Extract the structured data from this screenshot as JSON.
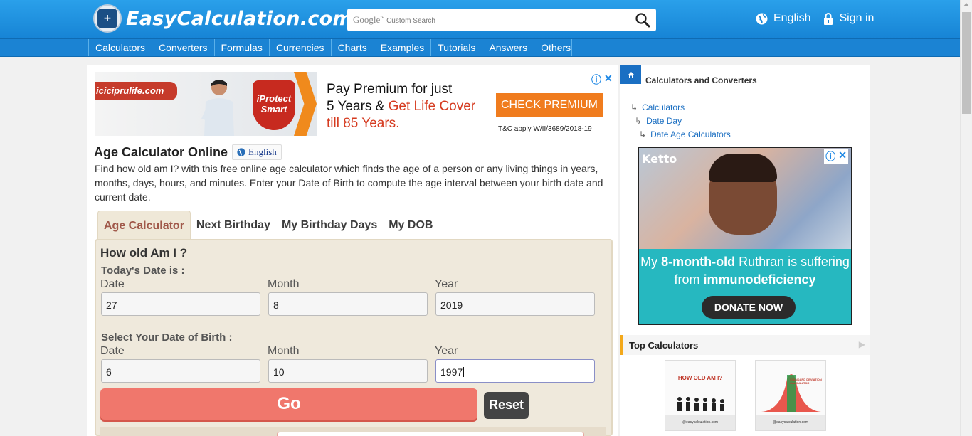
{
  "header": {
    "logo_text": "EasyCalculation.com",
    "search_placeholder_brand": "Google",
    "search_placeholder": "Custom Search",
    "language": "English",
    "sign_in": "Sign in"
  },
  "nav": {
    "items": [
      "Calculators",
      "Converters",
      "Formulas",
      "Currencies",
      "Charts",
      "Examples",
      "Tutorials",
      "Answers",
      "Others"
    ]
  },
  "ad_top": {
    "brand": "iciciprulife.com",
    "shield_line1": "iProtect",
    "shield_line2": "Smart",
    "line1": "Pay Premium for just",
    "line2_a": "5 Years & ",
    "line2_b": "Get Life Cover",
    "line3": "till 85 Years.",
    "cta": "CHECK PREMIUM",
    "tnc": "T&C apply W/II/3689/2018-19"
  },
  "page": {
    "title": "Age Calculator Online",
    "lang_button": "English",
    "description": "Find how old am I? with this free online age calculator which finds the age of a person or any living things in years, months, days, hours, and minutes. Enter your Date of Birth to compute the age interval between your birth date and current date."
  },
  "tabs": [
    "Age Calculator",
    "Next Birthday",
    "My Birthday Days",
    "My DOB"
  ],
  "form": {
    "heading": "How old Am I ?",
    "today_label": "Today's Date is :",
    "dob_label": "Select Your Date of Birth :",
    "col_date": "Date",
    "col_month": "Month",
    "col_year": "Year",
    "today": {
      "date": "27",
      "month": "8",
      "year": "2019"
    },
    "dob": {
      "date": "6",
      "month": "10",
      "year": "1997"
    },
    "go": "Go",
    "reset": "Reset"
  },
  "sidebar": {
    "title": "Calculators and Converters",
    "breadcrumbs": [
      "Calculators",
      "Date Day",
      "Date Age Calculators"
    ],
    "ad": {
      "brand": "Ketto",
      "msg_a": "My ",
      "msg_b": "8-month-old",
      "msg_c": " Ruthran is suffering from ",
      "msg_d": "immunodeficiency",
      "cta": "DONATE NOW"
    },
    "top_calculators": "Top Calculators",
    "thumb1": {
      "title": "HOW OLD AM I?",
      "foot": "@easycalculation.com"
    },
    "thumb2": {
      "title": "STANDARD DEVIATION CALCULATOR",
      "foot": "@easycalculation.com"
    }
  },
  "colors": {
    "header_blue": "#1784d5",
    "go_button": "#f0776c",
    "tab_active_text": "#a0584a",
    "ad_orange": "#f07c1e",
    "ketto_teal": "#26b8c0"
  }
}
